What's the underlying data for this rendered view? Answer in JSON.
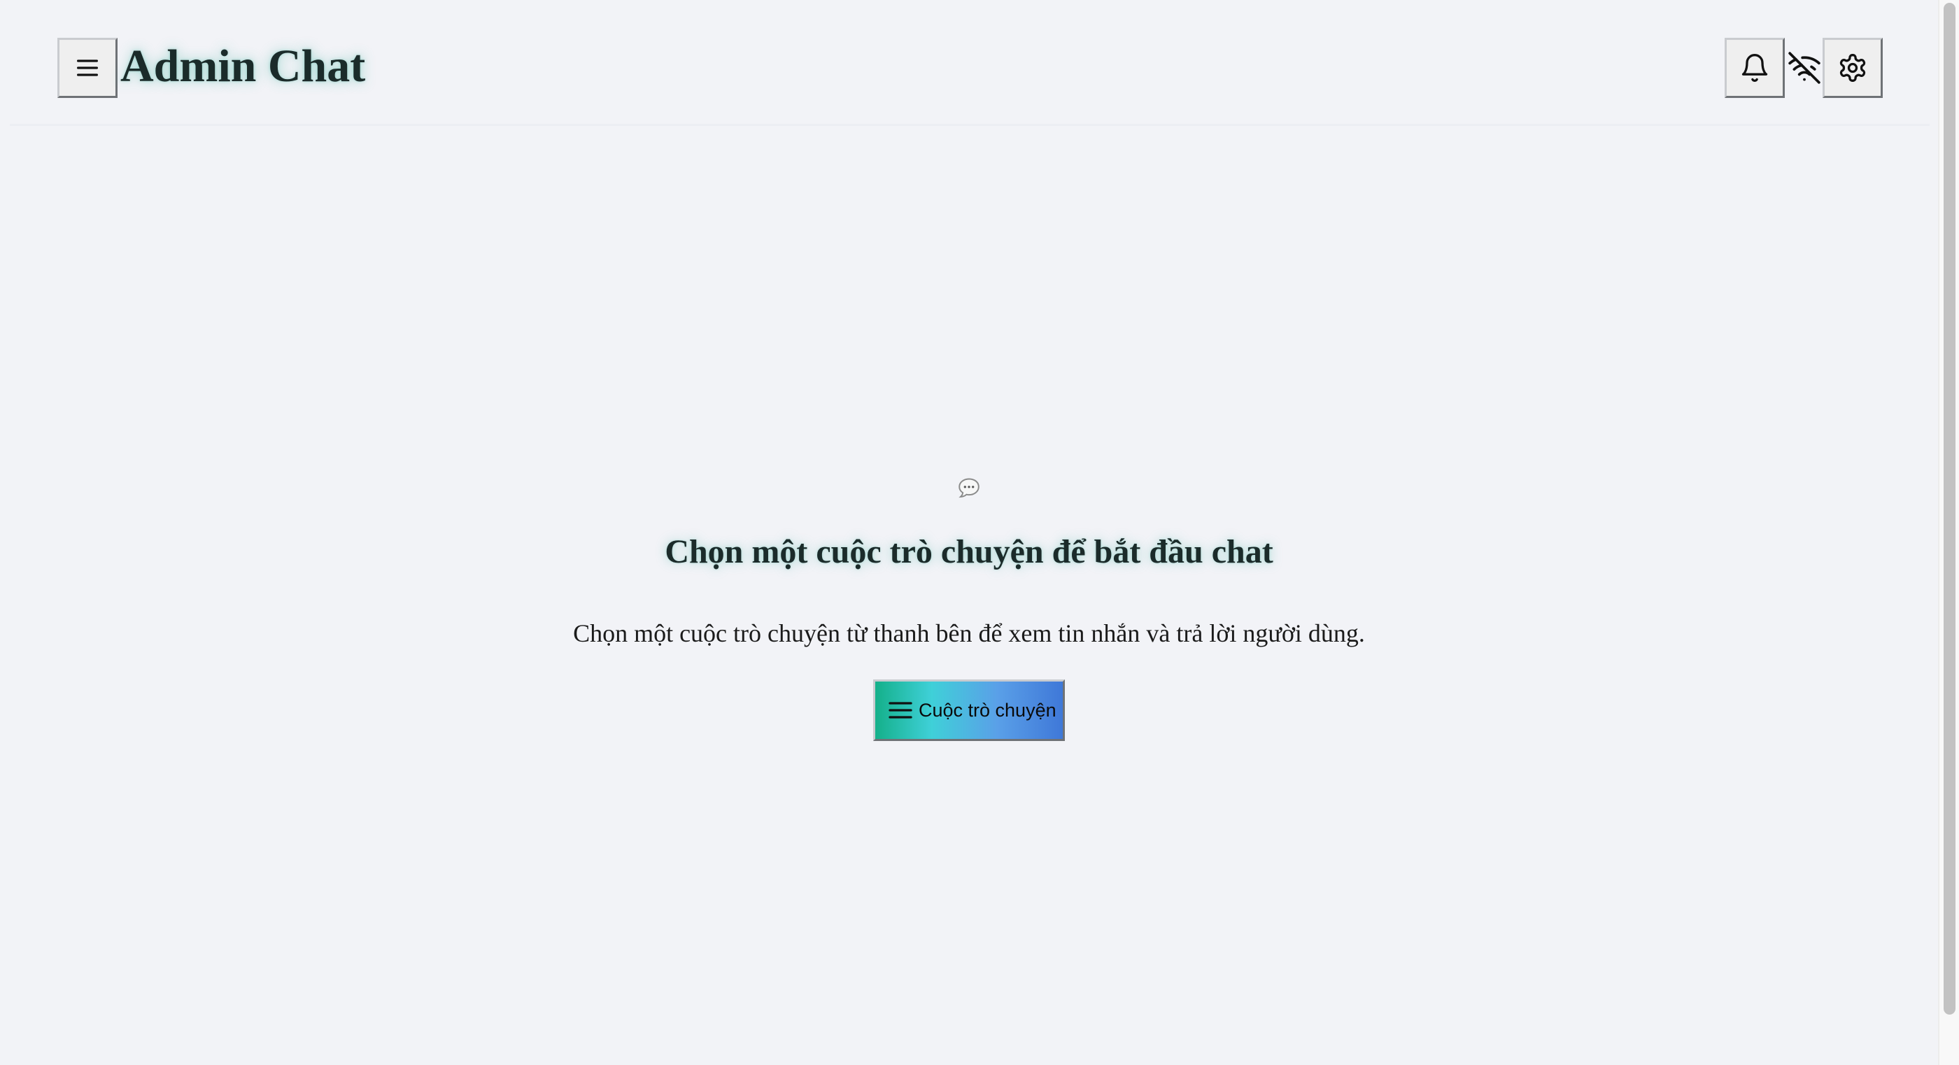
{
  "header": {
    "title": "Admin Chat",
    "menu_icon": "hamburger-menu-icon",
    "notifications_icon": "bell-icon",
    "connection_status_icon": "wifi-off-icon",
    "settings_icon": "gear-icon"
  },
  "empty_state": {
    "icon": "chat-bubble-icon",
    "title": "Chọn một cuộc trò chuyện để bắt đầu chat",
    "description": "Chọn một cuộc trò chuyện từ thanh bên để xem tin nhắn và trả lời người dùng.",
    "button_label": "Cuộc trò chuyện",
    "button_icon": "hamburger-menu-icon"
  },
  "colors": {
    "background": "#f2f3f7",
    "title_glow": "#3cb4a0",
    "button_gradient_start": "#14b08a",
    "button_gradient_mid": "#3fd0d8",
    "button_gradient_end": "#3f78d8"
  }
}
